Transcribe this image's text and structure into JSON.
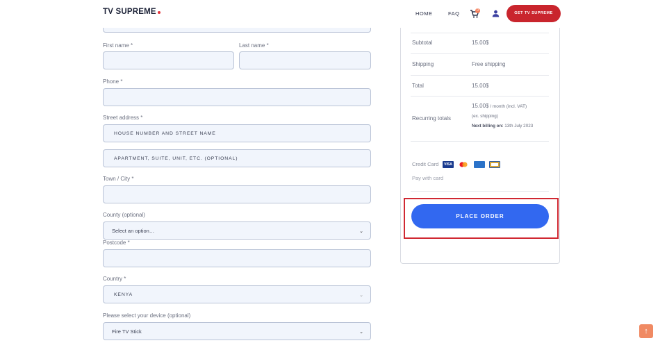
{
  "header": {
    "logo": "TV SUPREME",
    "nav_home": "HOME",
    "nav_faq": "FAQ",
    "cart_count": "0",
    "cta": "GET TV SUPREME"
  },
  "form": {
    "first_name_label": "First name *",
    "last_name_label": "Last name *",
    "phone_label": "Phone *",
    "street_label": "Street address  *",
    "street_placeholder": "HOUSE NUMBER AND STREET NAME",
    "street2_placeholder": "APARTMENT, SUITE, UNIT, ETC. (OPTIONAL)",
    "town_label": "Town / City  *",
    "county_label": "County (optional)",
    "county_value": "Select an option…",
    "postcode_label": "Postcode  *",
    "country_label": "Country *",
    "country_value": "KENYA",
    "device_label": "Please select your device (optional)",
    "device_value": "Fire TV Stick"
  },
  "summary": {
    "subtotal_label": "Subtotal",
    "subtotal_value": "15.00$",
    "shipping_label": "Shipping",
    "shipping_value": "Free shipping",
    "total_label": "Total",
    "total_value": "15.00$",
    "recurring_label": "Recurring totals",
    "recurring_amount": "15.00$",
    "recurring_period": " / month (incl. VAT)",
    "recurring_shipping": "(ex. shipping)",
    "next_billing_label": "Next billing on:",
    "next_billing_date": " 13th July 2023",
    "payment_method": "Credit Card",
    "pay_note": "Pay with card",
    "place_order": "PLACE ORDER"
  },
  "scroll_top_icon": "arrow-up-icon"
}
